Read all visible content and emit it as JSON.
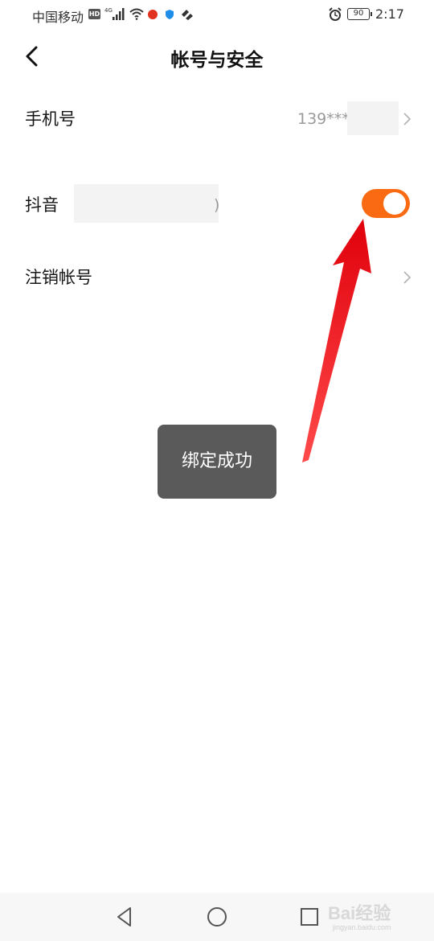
{
  "status_bar": {
    "carrier": "中国移动",
    "hd": "HD",
    "network": "4G",
    "battery": "90",
    "time": "2:17"
  },
  "header": {
    "title": "帐号与安全",
    "back_icon": "chevron-left-icon"
  },
  "rows": {
    "phone": {
      "label": "手机号",
      "value": "139***"
    },
    "douyin": {
      "label": "抖音",
      "id_suffix": ")",
      "bound": true,
      "toggle_color": "#fa6a12"
    },
    "cancel": {
      "label": "注销帐号"
    }
  },
  "toast": {
    "text": "绑定成功"
  },
  "watermark": {
    "text": "Bai经验",
    "sub": "jingyan.baidu.com"
  },
  "colors": {
    "accent": "#fa6a12",
    "arrow": "#e8131a",
    "toast_bg": "#5a5a5a"
  }
}
